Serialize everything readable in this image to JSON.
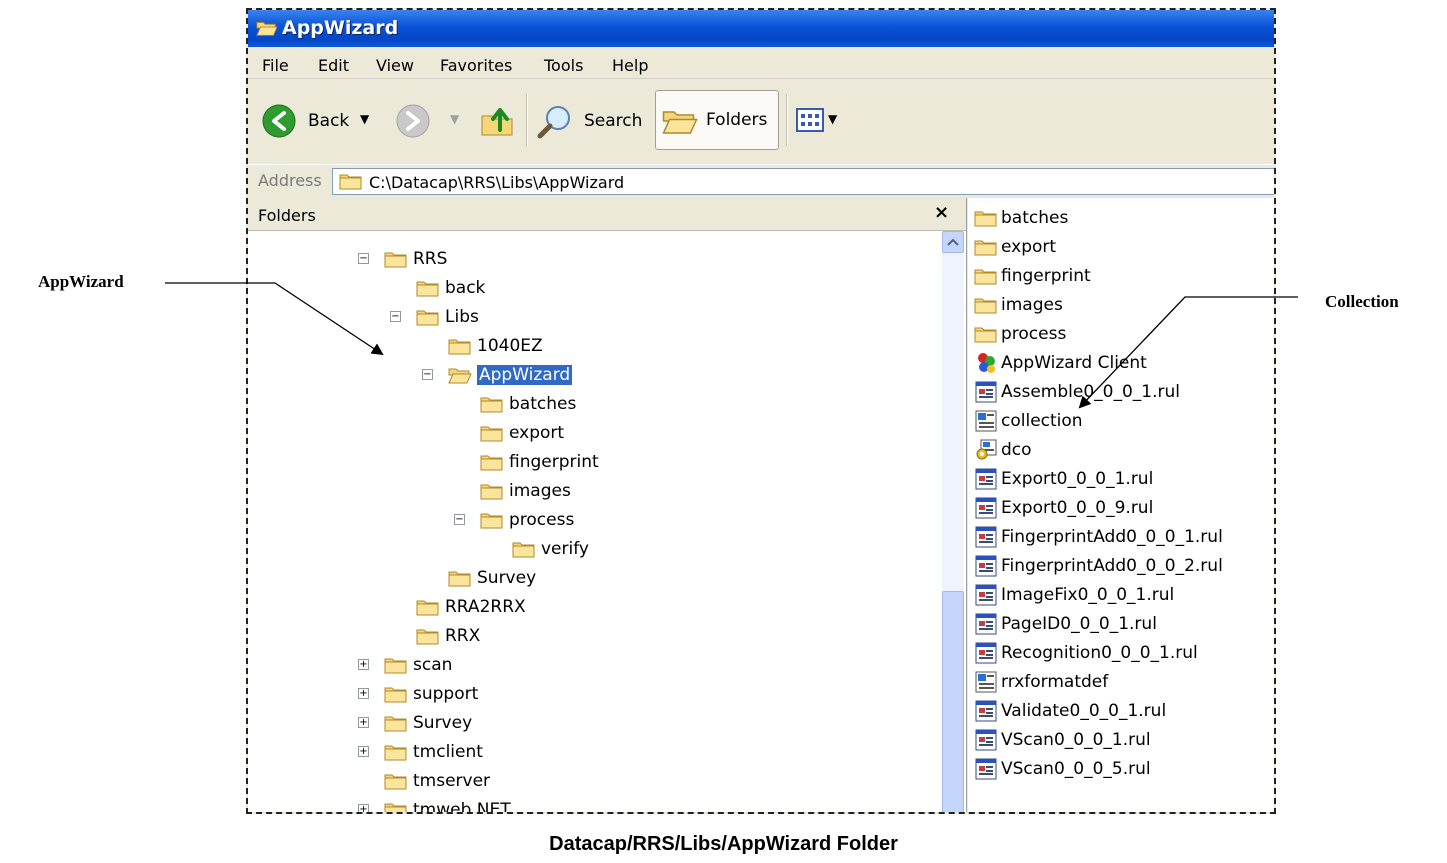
{
  "annotations": {
    "left_callout": "AppWizard",
    "right_callout": "Collection",
    "caption": "Datacap/RRS/Libs/AppWizard Folder"
  },
  "window": {
    "title": "AppWizard",
    "menu": [
      "File",
      "Edit",
      "View",
      "Favorites",
      "Tools",
      "Help"
    ],
    "toolbar": {
      "back": "Back",
      "search": "Search",
      "folders": "Folders"
    },
    "address": {
      "label": "Address",
      "value": "C:\\Datacap\\RRS\\Libs\\AppWizard"
    },
    "folders_pane": {
      "header": "Folders",
      "close": "×",
      "tree": [
        {
          "label": "RRS",
          "expander": "minus"
        },
        {
          "label": "back",
          "expander": "none"
        },
        {
          "label": "Libs",
          "expander": "minus"
        },
        {
          "label": "1040EZ",
          "expander": "none"
        },
        {
          "label": "AppWizard",
          "expander": "minus",
          "selected": true
        },
        {
          "label": "batches",
          "expander": "none"
        },
        {
          "label": "export",
          "expander": "none"
        },
        {
          "label": "fingerprint",
          "expander": "none"
        },
        {
          "label": "images",
          "expander": "none"
        },
        {
          "label": "process",
          "expander": "minus"
        },
        {
          "label": "verify",
          "expander": "none"
        },
        {
          "label": "Survey",
          "expander": "none"
        },
        {
          "label": "RRA2RRX",
          "expander": "none"
        },
        {
          "label": "RRX",
          "expander": "none"
        },
        {
          "label": "scan",
          "expander": "plus"
        },
        {
          "label": "support",
          "expander": "plus"
        },
        {
          "label": "Survey",
          "expander": "plus"
        },
        {
          "label": "tmclient",
          "expander": "plus"
        },
        {
          "label": "tmserver",
          "expander": "none"
        },
        {
          "label": "tmweb.NET",
          "expander": "plus"
        }
      ]
    },
    "files": [
      {
        "name": "batches",
        "icon": "folder-icon"
      },
      {
        "name": "export",
        "icon": "folder-icon"
      },
      {
        "name": "fingerprint",
        "icon": "folder-icon"
      },
      {
        "name": "images",
        "icon": "folder-icon"
      },
      {
        "name": "process",
        "icon": "folder-icon"
      },
      {
        "name": "AppWizard Client",
        "icon": "app-client-icon"
      },
      {
        "name": "Assemble0_0_0_1.rul",
        "icon": "rule-file-icon"
      },
      {
        "name": "collection",
        "icon": "xml-file-icon"
      },
      {
        "name": "dco",
        "icon": "dco-file-icon"
      },
      {
        "name": "Export0_0_0_1.rul",
        "icon": "rule-file-icon"
      },
      {
        "name": "Export0_0_0_9.rul",
        "icon": "rule-file-icon"
      },
      {
        "name": "FingerprintAdd0_0_0_1.rul",
        "icon": "rule-file-icon"
      },
      {
        "name": "FingerprintAdd0_0_0_2.rul",
        "icon": "rule-file-icon"
      },
      {
        "name": "ImageFix0_0_0_1.rul",
        "icon": "rule-file-icon"
      },
      {
        "name": "PageID0_0_0_1.rul",
        "icon": "rule-file-icon"
      },
      {
        "name": "Recognition0_0_0_1.rul",
        "icon": "rule-file-icon"
      },
      {
        "name": "rrxformatdef",
        "icon": "xml-file-icon"
      },
      {
        "name": "Validate0_0_0_1.rul",
        "icon": "rule-file-icon"
      },
      {
        "name": "VScan0_0_0_1.rul",
        "icon": "rule-file-icon"
      },
      {
        "name": "VScan0_0_0_5.rul",
        "icon": "rule-file-icon"
      }
    ]
  }
}
